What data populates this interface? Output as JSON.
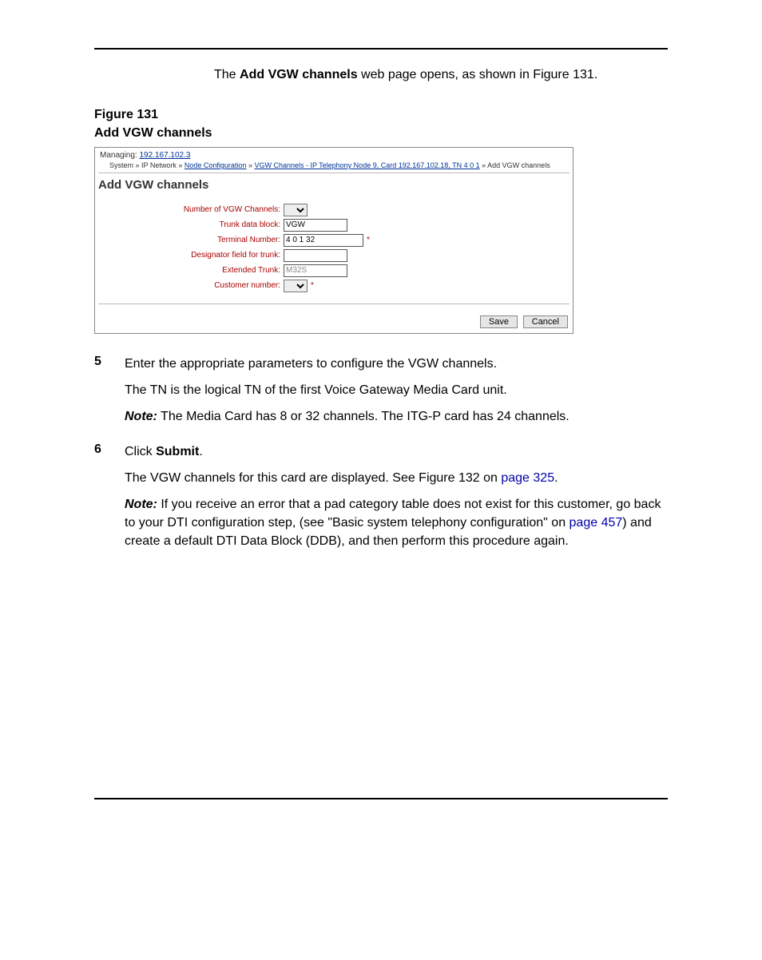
{
  "intro": {
    "pre": "The ",
    "bold": "Add VGW channels",
    "post": " web page opens, as shown in Figure 131."
  },
  "figcap": {
    "l1": "Figure 131",
    "l2": "Add VGW channels"
  },
  "shot": {
    "managing_label": "Managing: ",
    "managing_ip": "192.167.102.3",
    "crumb_pre": "System » IP Network » ",
    "crumb_link1": "Node Configuration",
    "crumb_sep": " » ",
    "crumb_link2": "VGW Channels - IP Telephony Node 9, Card 192.167.102.18, TN 4 0 1",
    "crumb_tail": " » Add VGW channels",
    "title": "Add VGW channels",
    "rows": {
      "num_vgw": "Number of VGW Channels:",
      "trunk_block": "Trunk data block:",
      "trunk_block_val": "VGW",
      "terminal": "Terminal Number:",
      "terminal_val": "4 0 1 32",
      "designator": "Designator field for trunk:",
      "extended": "Extended Trunk:",
      "extended_val": "M32S",
      "customer": "Customer number:"
    },
    "star": "*",
    "save": "Save",
    "cancel": "Cancel"
  },
  "step5": {
    "num": "5",
    "p1": "Enter the appropriate parameters to configure the VGW channels.",
    "p2": "The TN is the logical TN of the first Voice Gateway Media Card unit.",
    "note_lbl": "Note:",
    "note_txt": "  The Media Card has 8 or 32 channels. The ITG-P card has 24 channels."
  },
  "step6": {
    "num": "6",
    "p1_pre": "Click ",
    "p1_bold": "Submit",
    "p1_post": ".",
    "p2_pre": "The VGW channels for this card are displayed. See Figure 132 on ",
    "p2_lnk": "page 325",
    "p2_post": ".",
    "note_lbl": "Note:",
    "note_txt1": "  If you receive an error that a pad category table does not exist for this customer, go back to your DTI configuration step, (see \"Basic system telephony configuration\" on ",
    "note_lnk": "page 457",
    "note_txt2": ") and create a default DTI Data Block (DDB), and then perform this procedure again."
  }
}
